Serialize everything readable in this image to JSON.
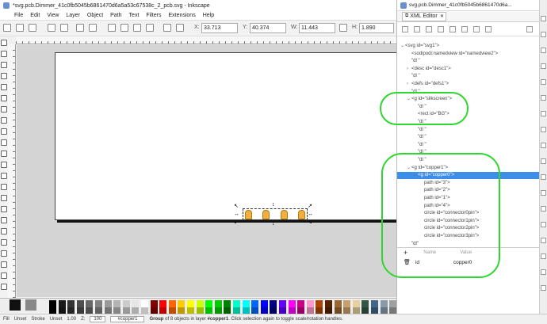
{
  "window": {
    "title": "*svg.pcb.Dimmer_41c0fb5045b6861470d6a5a53c67538c_2_pcb.svg - Inkscape"
  },
  "menu": [
    "File",
    "Edit",
    "View",
    "Layer",
    "Object",
    "Path",
    "Text",
    "Filters",
    "Extensions",
    "Help"
  ],
  "toolbar": {
    "x_label": "X:",
    "x_value": "33.713",
    "y_label": "Y:",
    "y_value": "40.374",
    "w_label": "W:",
    "w_value": "11.443",
    "h_label": "H:",
    "h_value": "1.890"
  },
  "xml_panel": {
    "window_title": "svg.pcb.Dimmer_41c0fb5045b6861470d6a...",
    "tab_label": "XML Editor",
    "nodes": [
      {
        "text": "<svg id=\"svg1\">",
        "indent": 0,
        "tw": "⌄"
      },
      {
        "text": "<sodipodi:namedview id=\"namedview2\">",
        "indent": 1,
        "tw": ""
      },
      {
        "text": "\"dl     \"",
        "indent": 1,
        "tw": ""
      },
      {
        "text": "<desc id=\"desc1\">",
        "indent": 1,
        "tw": "›"
      },
      {
        "text": "\"dl  \"",
        "indent": 1,
        "tw": ""
      },
      {
        "text": "<defs id=\"defs1\">",
        "indent": 1,
        "tw": "›"
      },
      {
        "text": "\"dl  \"",
        "indent": 1,
        "tw": ""
      },
      {
        "text": "<g id=\"silkscreen\">",
        "indent": 1,
        "tw": "⌄"
      },
      {
        "text": "\"dl       \"",
        "indent": 2,
        "tw": ""
      },
      {
        "text": "<rect id=\"BG\">",
        "indent": 2,
        "tw": ""
      },
      {
        "text": "\"dl       \"",
        "indent": 2,
        "tw": ""
      },
      {
        "text": "\"dl       \"",
        "indent": 2,
        "tw": ""
      },
      {
        "text": "\"dl       \"",
        "indent": 2,
        "tw": ""
      },
      {
        "text": "\"dl       \"",
        "indent": 2,
        "tw": ""
      },
      {
        "text": "\"dl       \"",
        "indent": 2,
        "tw": ""
      },
      {
        "text": "\"dl       \"",
        "indent": 2,
        "tw": ""
      },
      {
        "text": "<g id=\"copper1\">",
        "indent": 1,
        "tw": "⌄"
      },
      {
        "text": "<g id=\"copper0\">",
        "indent": 2,
        "tw": "⌄",
        "selected": true
      },
      {
        "text": "path id=\"3\">",
        "indent": 3,
        "tw": ""
      },
      {
        "text": "path id=\"2\">",
        "indent": 3,
        "tw": ""
      },
      {
        "text": "path id=\"1\">",
        "indent": 3,
        "tw": ""
      },
      {
        "text": "path id=\"4\">",
        "indent": 3,
        "tw": ""
      },
      {
        "text": "circle id=\"connector0pin\">",
        "indent": 3,
        "tw": ""
      },
      {
        "text": "circle id=\"connector1pin\">",
        "indent": 3,
        "tw": ""
      },
      {
        "text": "circle id=\"connector2pin\">",
        "indent": 3,
        "tw": ""
      },
      {
        "text": "circle id=\"connector3pin\">",
        "indent": 3,
        "tw": ""
      },
      {
        "text": "\"dl\"",
        "indent": 1,
        "tw": ""
      }
    ],
    "attr_header_name": "Name",
    "attr_header_value": "Value",
    "attr_name": "id",
    "attr_value": "copper0"
  },
  "fill_label": "Fill",
  "stroke_label": "Stroke",
  "fill_value": "Unset",
  "stroke_value": "Unset",
  "opacity_value": "1.00",
  "status": {
    "zoom_label": "Z:",
    "zoom_value": "100",
    "layer": "#copper1",
    "message_prefix": "Group",
    "message_rest": " of 8 objects in layer ",
    "message_layer": "#copper1",
    "message_tail": ". Click selection again to toggle scale/rotation handles."
  },
  "palette_colors": [
    "#000000",
    "#1a1a1a",
    "#333333",
    "#4d4d4d",
    "#666666",
    "#808080",
    "#999999",
    "#b3b3b3",
    "#cccccc",
    "#e6e6e6",
    "#ffffff",
    "#800000",
    "#ff0000",
    "#ff6600",
    "#ffcc00",
    "#ffff00",
    "#ccff00",
    "#00ff00",
    "#00cc00",
    "#008000",
    "#00ffcc",
    "#00ffff",
    "#0066ff",
    "#0000ff",
    "#000080",
    "#6600ff",
    "#ff00ff",
    "#cc0088",
    "#ff99cc",
    "#aa4400",
    "#552200",
    "#996633",
    "#c8a070",
    "#e6d0a0",
    "#335544",
    "#446688",
    "#8899aa",
    "#a0a0a0"
  ],
  "annotation_color": "#2fd62f"
}
